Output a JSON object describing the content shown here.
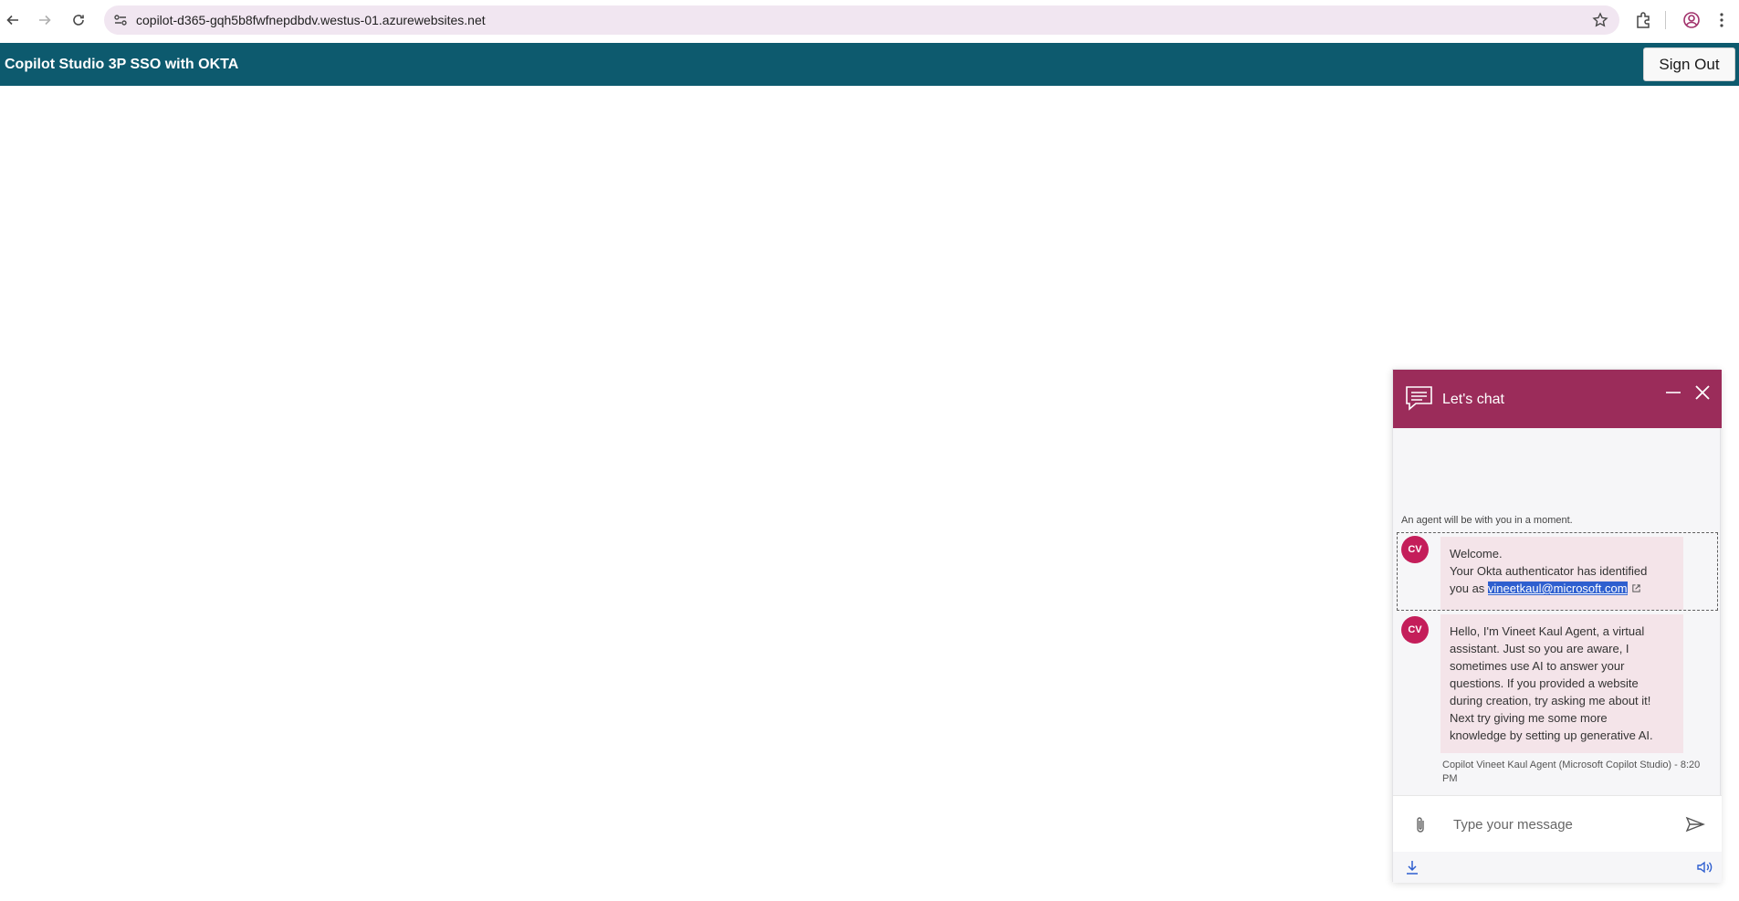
{
  "browser": {
    "url": "copilot-d365-gqh5b8fwfnepdbdv.westus-01.azurewebsites.net"
  },
  "app": {
    "title": "Copilot Studio 3P SSO with OKTA",
    "sign_out_label": "Sign Out"
  },
  "chat": {
    "header_title": "Let's chat",
    "notice": "An agent will be with you in a moment.",
    "messages": [
      {
        "avatar": "CV",
        "lines": [
          "Welcome.",
          "Your Okta authenticator has identified",
          "you as "
        ],
        "link": "vineetkaul@microsoft.com"
      },
      {
        "avatar": "CV",
        "lines": [
          "Hello, I'm Vineet Kaul Agent, a virtual",
          "assistant. Just so you are aware, I",
          "sometimes use AI to answer your",
          "questions. If you provided a website",
          "during creation, try asking me about it!",
          "Next try giving me some more",
          "knowledge by setting up generative AI."
        ]
      }
    ],
    "timestamp_line1": "Copilot Vineet Kaul Agent (Microsoft Copilot Studio) - 8:20",
    "timestamp_line2": "PM",
    "input_placeholder": "Type your message"
  },
  "colors": {
    "app_header": "#0d5a6e",
    "chat_header": "#9b2c5a",
    "avatar": "#c41e5a",
    "bubble": "#f4e4e9",
    "link_highlight": "#2f5fcf"
  }
}
